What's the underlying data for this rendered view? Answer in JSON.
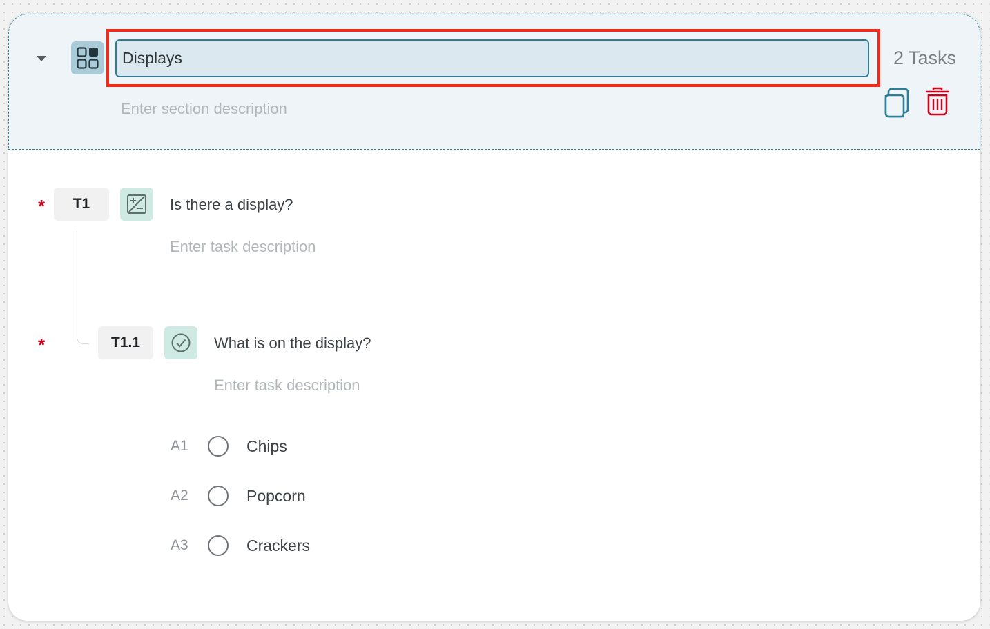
{
  "section": {
    "title_value": "Displays",
    "description_placeholder": "Enter section description",
    "task_count": "2 Tasks",
    "icons": {
      "collapse": "caret-down-icon",
      "section": "grid-icon",
      "copy": "copy-icon",
      "delete": "trash-icon"
    }
  },
  "tasks": [
    {
      "id": "T1",
      "required_mark": "*",
      "type_icon": "plus-minus-icon",
      "title": "Is there a display?",
      "description_placeholder": "Enter task description"
    },
    {
      "id": "T1.1",
      "required_mark": "*",
      "type_icon": "check-circle-icon",
      "title": "What is on the display?",
      "description_placeholder": "Enter task description",
      "answers": [
        {
          "code": "A1",
          "label": "Chips"
        },
        {
          "code": "A2",
          "label": "Popcorn"
        },
        {
          "code": "A3",
          "label": "Crackers"
        }
      ]
    }
  ],
  "colors": {
    "accent": "#2c7f97",
    "highlight": "#f22a17",
    "required": "#d0021b",
    "delete": "#d0021b",
    "header_bg": "#eef4f8",
    "task_icon_bg": "#cfe9e3"
  }
}
